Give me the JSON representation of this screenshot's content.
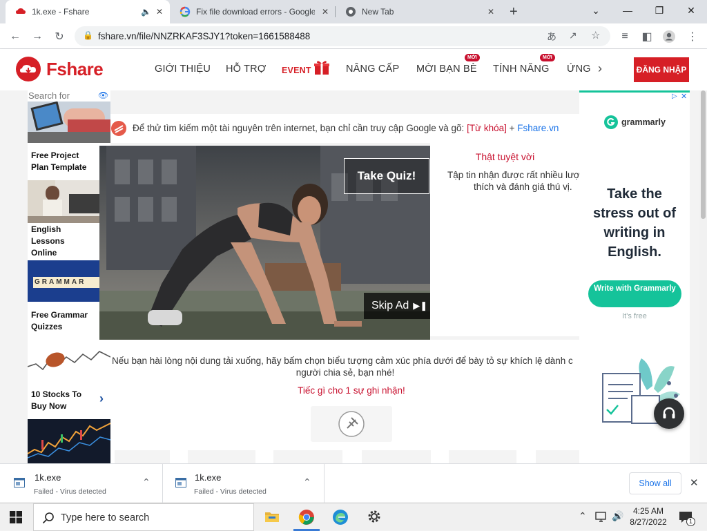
{
  "browser": {
    "tabs": [
      {
        "title": "1k.exe - Fshare",
        "active": true
      },
      {
        "title": "Fix file download errors - Google",
        "active": false
      },
      {
        "title": "New Tab",
        "active": false
      }
    ],
    "url": "fshare.vn/file/NNZRKAF3SJY1?token=1661588488"
  },
  "site": {
    "logo_text": "Fshare",
    "nav": [
      "GIỚI THIỆU",
      "HỖ TRỢ",
      "EVENT",
      "NÂNG CẤP",
      "MỜI BẠN BÈ",
      "TÍNH NĂNG",
      "ỨNG"
    ],
    "badge": "MỚI",
    "login": "ĐĂNG NHẬP"
  },
  "left_ads": {
    "search_placeholder": "Search for",
    "items": [
      "Free Project Plan Template",
      "English Lessons Online",
      "Free Grammar Quizzes",
      "10 Stocks To Buy Now"
    ],
    "grammar_tile": "GRAMMAR"
  },
  "main": {
    "info_line": "Để thử tìm kiếm một tài nguyên trên internet, bạn chỉ cần truy cập Google và gõ:",
    "info_keyword": "[Từ khóa]",
    "info_plus": "+",
    "info_site": "Fshare.vn",
    "right_title": "Thật tuyệt vời",
    "right_text_1": "Tập tin nhận được rất nhiều lượ",
    "right_text_2": "thích và đánh giá thú vị.",
    "rate_line_1": "Nếu bạn hài lòng nội dung tải xuống, hãy bấm chọn biểu tượng cảm xúc phía dưới để bày tỏ sự khích lệ dành c",
    "rate_line_2": "người chia sẻ, bạn nhé!",
    "rate_cta": "Tiếc gì cho 1 sự ghi nhận!"
  },
  "video_ad": {
    "quiz": "Take Quiz!",
    "skip": "Skip Ad"
  },
  "grammarly_ad": {
    "brand": "grammarly",
    "headline": "Take the stress out of writing in English.",
    "cta": "Write with Grammarly",
    "sub": "It's free"
  },
  "downloads": {
    "items": [
      {
        "name": "1k.exe",
        "status": "Failed - Virus detected"
      },
      {
        "name": "1k.exe",
        "status": "Failed - Virus detected"
      }
    ],
    "show_all": "Show all"
  },
  "taskbar": {
    "search_placeholder": "Type here to search",
    "time": "4:25 AM",
    "date": "8/27/2022",
    "notification_count": "1"
  },
  "colors": {
    "fshare_red": "#d61f26",
    "grammarly_green": "#15c39a",
    "link_blue": "#1a73e8"
  }
}
